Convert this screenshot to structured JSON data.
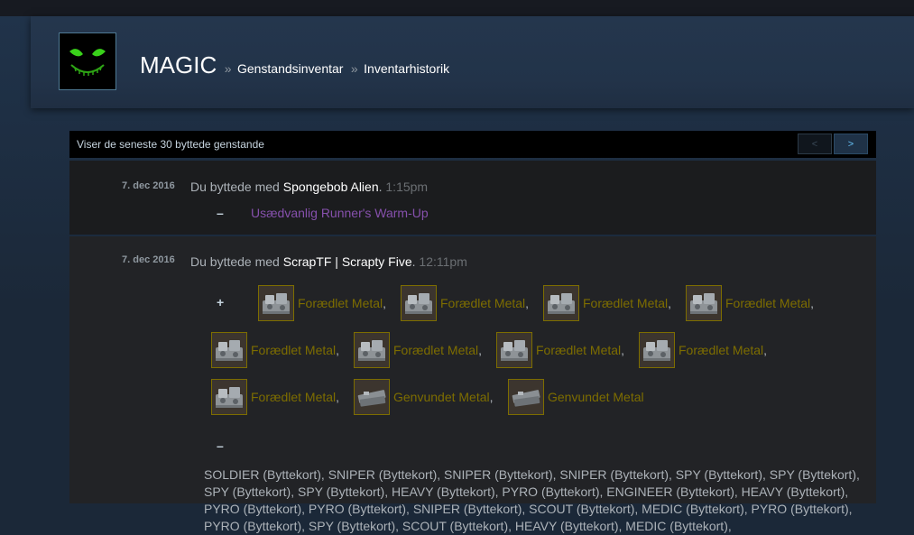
{
  "profile": {
    "name": "MAGIC",
    "breadcrumb_sep": "»",
    "crumb1": "Genstandsinventar",
    "crumb2": "Inventarhistorik"
  },
  "toolbar": {
    "label": "Viser de seneste 30 byttede genstande",
    "prev_label": "<",
    "next_label": ">"
  },
  "trades": [
    {
      "date": "7. dec 2016",
      "prefix": "Du byttede med ",
      "partner": "Spongebob Alien",
      "suffix": ".",
      "time": "1:15pm",
      "marker": "–",
      "item": "Usædvanlig Runner's Warm-Up"
    },
    {
      "date": "7. dec 2016",
      "prefix": "Du byttede med ",
      "partner": "ScrapTF | Scrapty Five",
      "suffix": ".",
      "time": "12:11pm",
      "plus_marker": "+",
      "minus_marker": "–",
      "received": [
        {
          "name": "Forædlet Metal",
          "sep": ",",
          "icon": "refined-metal-icon"
        },
        {
          "name": "Forædlet Metal",
          "sep": ",",
          "icon": "refined-metal-icon"
        },
        {
          "name": "Forædlet Metal",
          "sep": ",",
          "icon": "refined-metal-icon"
        },
        {
          "name": "Forædlet Metal",
          "sep": ",",
          "icon": "refined-metal-icon"
        },
        {
          "name": "Forædlet Metal",
          "sep": ",",
          "icon": "refined-metal-icon"
        },
        {
          "name": "Forædlet Metal",
          "sep": ",",
          "icon": "refined-metal-icon"
        },
        {
          "name": "Forædlet Metal",
          "sep": ",",
          "icon": "refined-metal-icon"
        },
        {
          "name": "Forædlet Metal",
          "sep": ",",
          "icon": "refined-metal-icon"
        },
        {
          "name": "Forædlet Metal",
          "sep": ",",
          "icon": "refined-metal-icon"
        },
        {
          "name": "Genvundet Metal",
          "sep": ",",
          "icon": "reclaimed-metal-icon"
        },
        {
          "name": "Genvundet Metal",
          "sep": "",
          "icon": "reclaimed-metal-icon"
        }
      ],
      "given_text": "SOLDIER (Byttekort), SNIPER (Byttekort), SNIPER (Byttekort), SNIPER (Byttekort), SPY (Byttekort), SPY (Byttekort), SPY (Byttekort), SPY (Byttekort), HEAVY (Byttekort), PYRO (Byttekort), ENGINEER (Byttekort), HEAVY (Byttekort), PYRO (Byttekort), PYRO (Byttekort), SNIPER (Byttekort), SCOUT (Byttekort), MEDIC (Byttekort), PYRO (Byttekort), PYRO (Byttekort), SPY (Byttekort), SCOUT (Byttekort), HEAVY (Byttekort), MEDIC (Byttekort),"
    }
  ],
  "colors": {
    "background": "#1b2838",
    "unique_item": "#7d6d00",
    "unusual_item": "#8650ac",
    "link_accent": "#66c0f4"
  }
}
